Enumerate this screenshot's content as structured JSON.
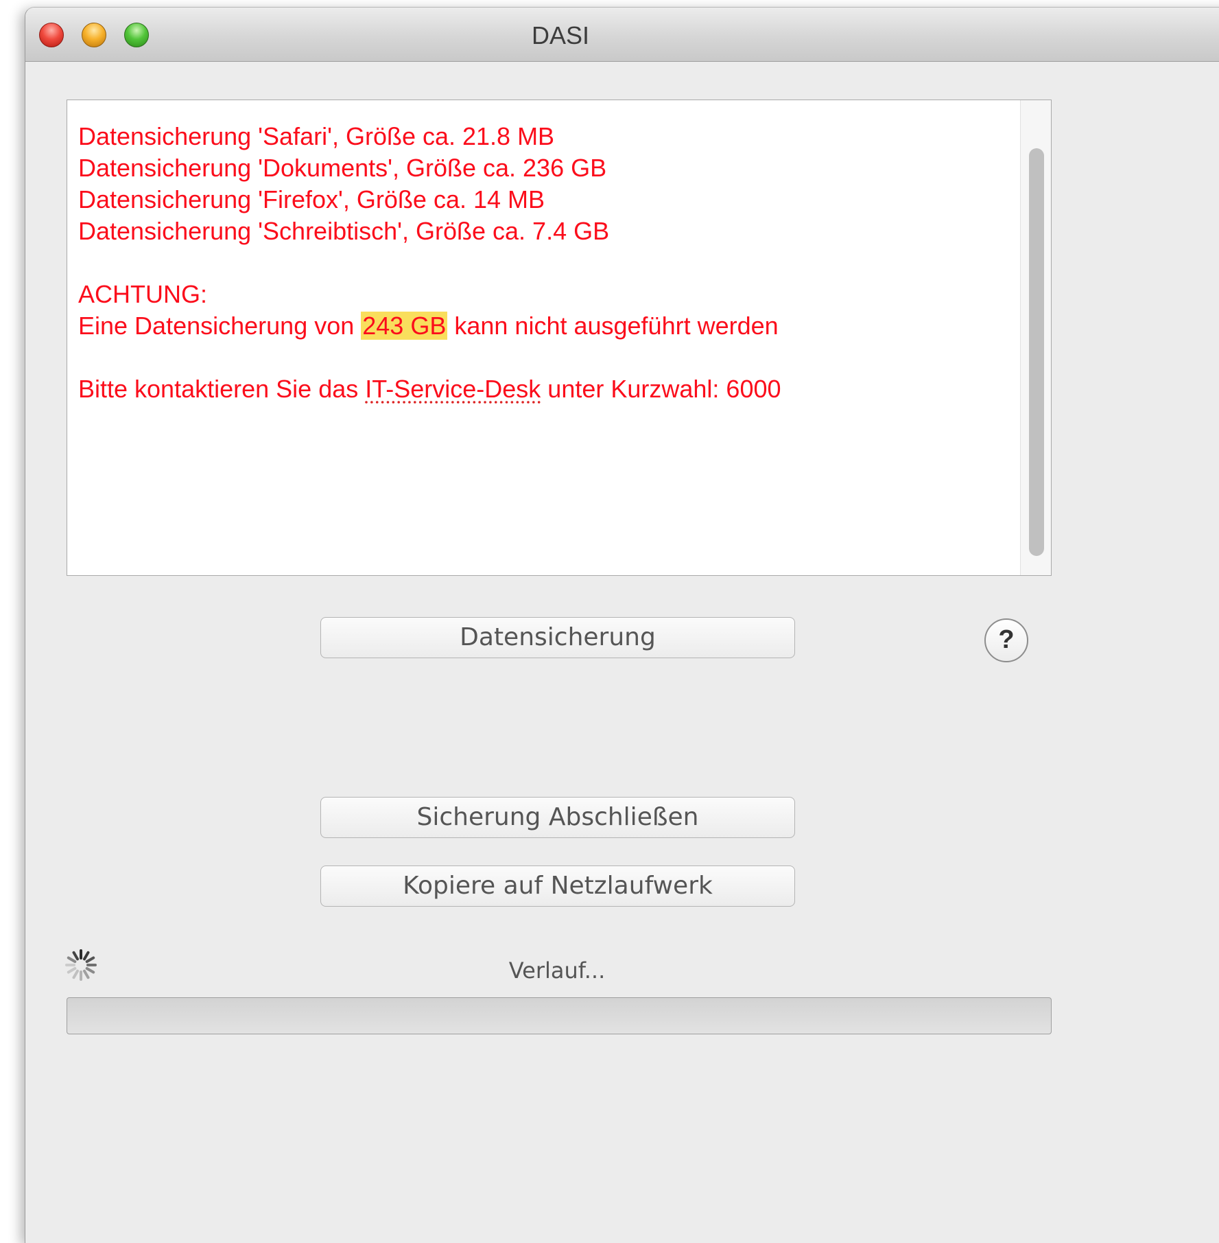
{
  "window": {
    "title": "DASI"
  },
  "log": {
    "backup_lines": [
      "Datensicherung 'Safari', Größe ca. 21.8 MB",
      "Datensicherung 'Dokuments', Größe ca. 236 GB",
      "Datensicherung 'Firefox', Größe ca. 14 MB",
      "Datensicherung 'Schreibtisch', Größe ca. 7.4 GB"
    ],
    "warning_heading": "ACHTUNG:",
    "warning_prefix": "Eine Datensicherung von ",
    "warning_size": "243 GB",
    "warning_suffix": " kann nicht ausgeführt werden",
    "contact_prefix": "Bitte kontaktieren Sie das ",
    "contact_service": "IT-Service-Desk",
    "contact_suffix": " unter Kurzwahl: 6000",
    "text_color": "#fb0d1b",
    "highlight_color": "#f9de5d"
  },
  "buttons": {
    "backup_label": "Datensicherung",
    "finish_label": "Sicherung Abschließen",
    "copy_label": "Kopiere auf Netzlaufwerk",
    "help_label": "?"
  },
  "status": {
    "text": "Verlauf...",
    "spinner_icon": "activity-spinner-icon",
    "progress_fraction": 0
  }
}
